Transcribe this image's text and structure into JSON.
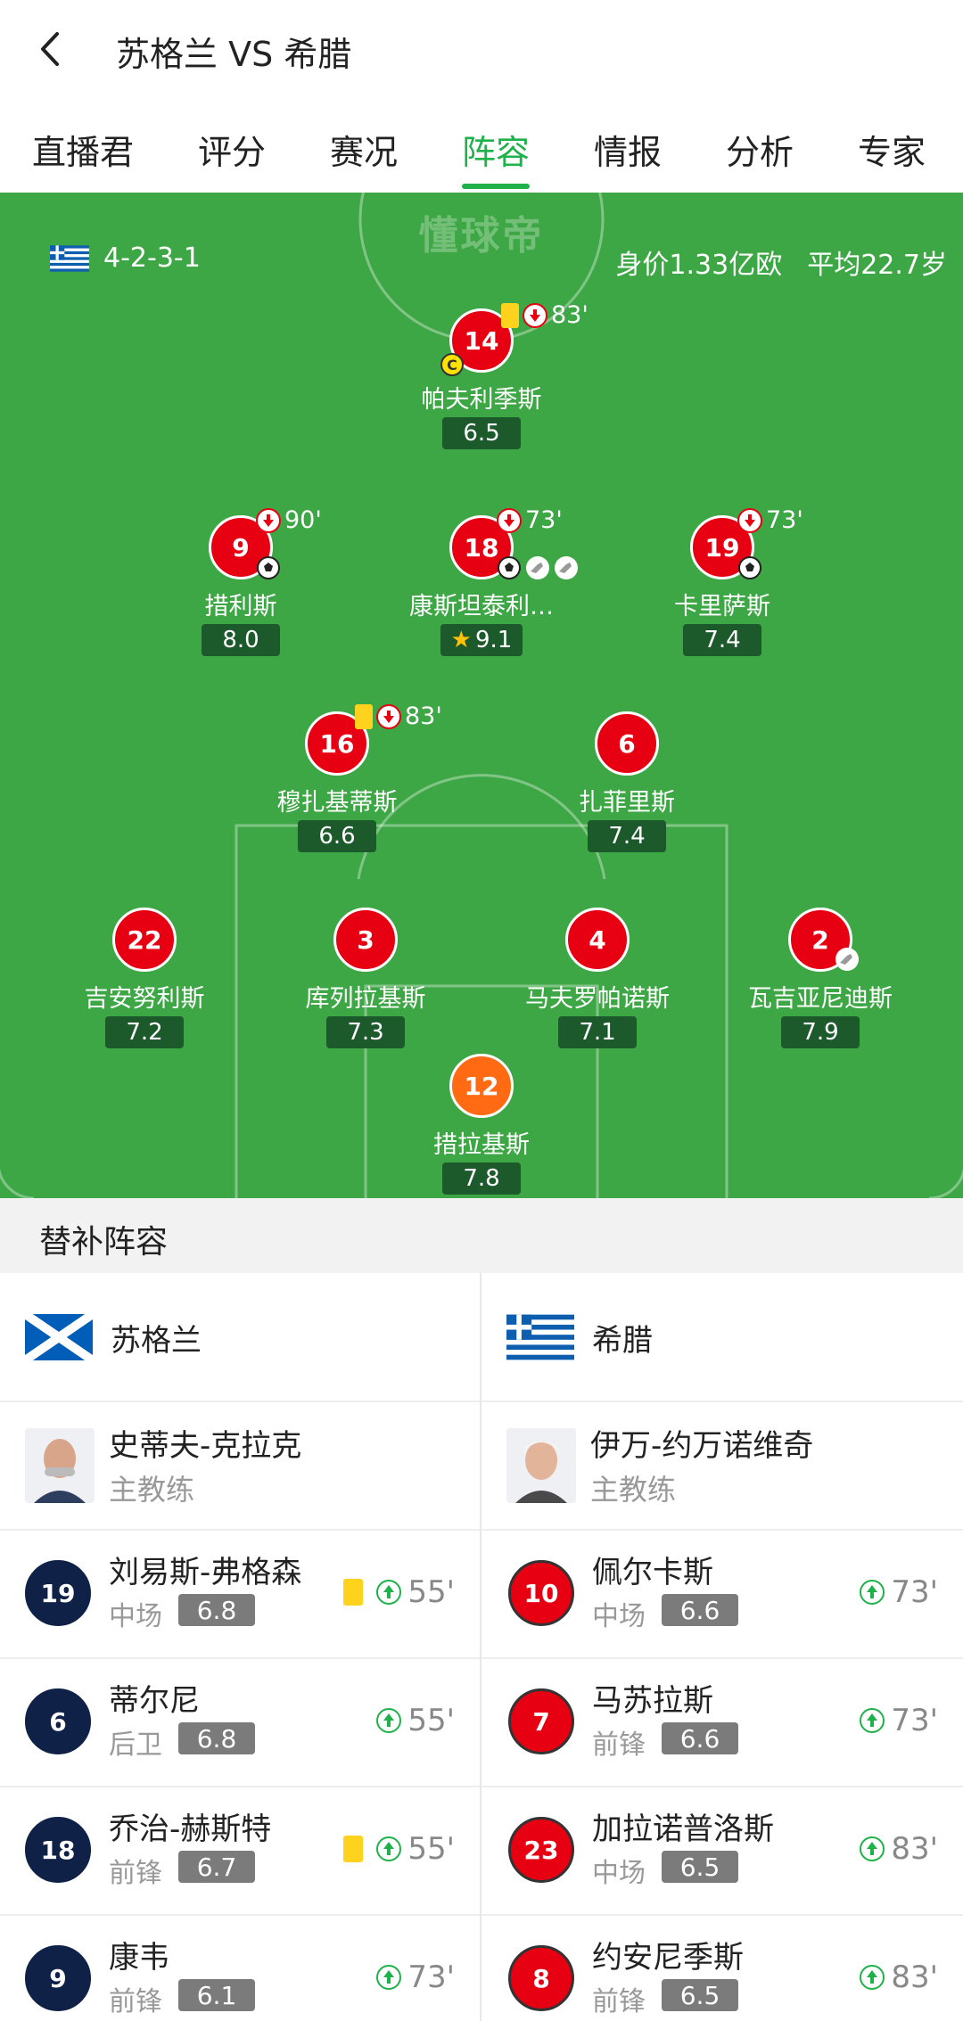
{
  "header": {
    "title": "苏格兰 VS 希腊"
  },
  "tabs": [
    "直播君",
    "评分",
    "赛况",
    "阵容",
    "情报",
    "分析",
    "专家"
  ],
  "active_tab": 3,
  "pitch": {
    "watermark": "懂球帝",
    "formation": "4-2-3-1",
    "value": "身价1.33亿欧",
    "avg_age": "平均22.7岁",
    "players": {
      "p14": {
        "number": "14",
        "name": "帕夫利季斯",
        "rating": "6.5",
        "sub_time": "83'"
      },
      "p9": {
        "number": "9",
        "name": "措利斯",
        "rating": "8.0",
        "sub_time": "90'"
      },
      "p18": {
        "number": "18",
        "name": "康斯坦泰利…",
        "rating": "9.1",
        "sub_time": "73'"
      },
      "p19": {
        "number": "19",
        "name": "卡里萨斯",
        "rating": "7.4",
        "sub_time": "73'"
      },
      "p16": {
        "number": "16",
        "name": "穆扎基蒂斯",
        "rating": "6.6",
        "sub_time": "83'"
      },
      "p6": {
        "number": "6",
        "name": "扎菲里斯",
        "rating": "7.4"
      },
      "p22": {
        "number": "22",
        "name": "吉安努利斯",
        "rating": "7.2"
      },
      "p3": {
        "number": "3",
        "name": "库列拉基斯",
        "rating": "7.3"
      },
      "p4": {
        "number": "4",
        "name": "马夫罗帕诺斯",
        "rating": "7.1"
      },
      "p2": {
        "number": "2",
        "name": "瓦吉亚尼迪斯",
        "rating": "7.9"
      },
      "p12": {
        "number": "12",
        "name": "措拉基斯",
        "rating": "7.8"
      }
    },
    "captain_mark": "C"
  },
  "subs_title": "替补阵容",
  "left": {
    "team": "苏格兰",
    "coach": {
      "name": "史蒂夫-克拉克",
      "role": "主教练"
    },
    "subs": [
      {
        "number": "19",
        "name": "刘易斯-弗格森",
        "pos": "中场",
        "rating": "6.8",
        "time": "55'",
        "yellow": true
      },
      {
        "number": "6",
        "name": "蒂尔尼",
        "pos": "后卫",
        "rating": "6.8",
        "time": "55'",
        "yellow": false
      },
      {
        "number": "18",
        "name": "乔治-赫斯特",
        "pos": "前锋",
        "rating": "6.7",
        "time": "55'",
        "yellow": true
      },
      {
        "number": "9",
        "name": "康韦",
        "pos": "前锋",
        "rating": "6.1",
        "time": "73'",
        "yellow": false
      }
    ]
  },
  "right": {
    "team": "希腊",
    "coach": {
      "name": "伊万-约万诺维奇",
      "role": "主教练"
    },
    "subs": [
      {
        "number": "10",
        "name": "佩尔卡斯",
        "pos": "中场",
        "rating": "6.6",
        "time": "73'"
      },
      {
        "number": "7",
        "name": "马苏拉斯",
        "pos": "前锋",
        "rating": "6.6",
        "time": "73'"
      },
      {
        "number": "23",
        "name": "加拉诺普洛斯",
        "pos": "中场",
        "rating": "6.5",
        "time": "83'"
      },
      {
        "number": "8",
        "name": "约安尼季斯",
        "pos": "前锋",
        "rating": "6.5",
        "time": "83'"
      }
    ]
  },
  "colors": {
    "accent": "#1fb24a",
    "pitch": "#3ea745",
    "player": "#e60012",
    "goalkeeper": "#ff6a13",
    "scotland": "#0f2147"
  }
}
